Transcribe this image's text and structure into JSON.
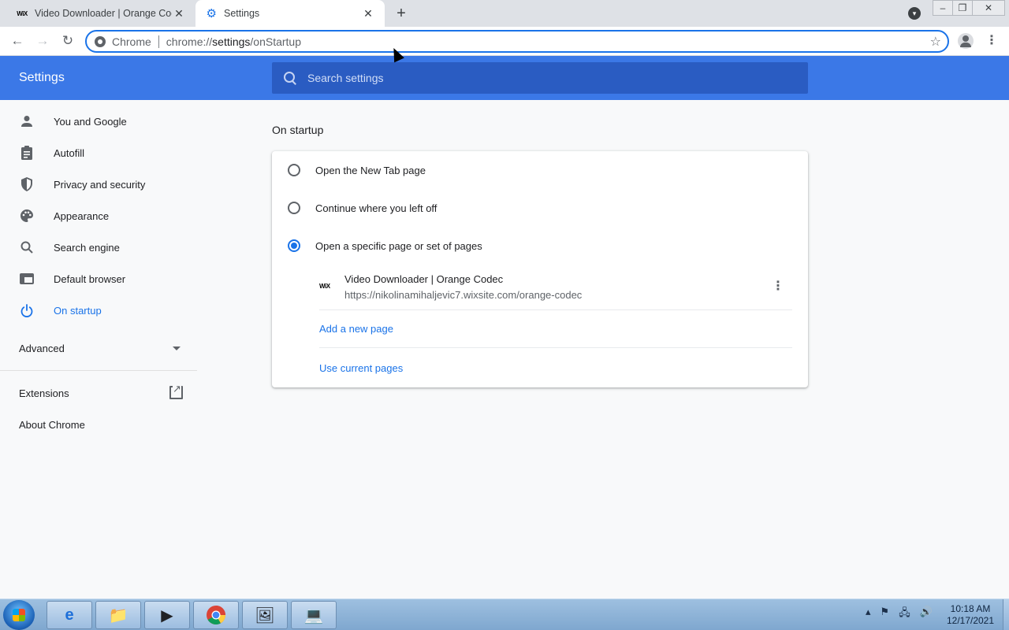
{
  "tabs": [
    {
      "title": "Video Downloader | Orange Cod",
      "favicon": "wix",
      "active": false
    },
    {
      "title": "Settings",
      "favicon": "gear-icon",
      "active": true
    }
  ],
  "toolbar": {
    "scheme_label": "Chrome",
    "url_prefix": "chrome://",
    "url_host": "settings",
    "url_path": "/onStartup"
  },
  "header": {
    "title": "Settings",
    "search_placeholder": "Search settings"
  },
  "sidebar": {
    "items": [
      {
        "label": "You and Google",
        "icon": "person-icon"
      },
      {
        "label": "Autofill",
        "icon": "clipboard-icon"
      },
      {
        "label": "Privacy and security",
        "icon": "shield-icon"
      },
      {
        "label": "Appearance",
        "icon": "palette-icon"
      },
      {
        "label": "Search engine",
        "icon": "search-icon"
      },
      {
        "label": "Default browser",
        "icon": "browser-window-icon"
      },
      {
        "label": "On startup",
        "icon": "power-icon",
        "selected": true
      }
    ],
    "advanced_label": "Advanced",
    "extensions_label": "Extensions",
    "about_label": "About Chrome"
  },
  "main": {
    "section_title": "On startup",
    "options": [
      {
        "label": "Open the New Tab page",
        "checked": false
      },
      {
        "label": "Continue where you left off",
        "checked": false
      },
      {
        "label": "Open a specific page or set of pages",
        "checked": true
      }
    ],
    "startup_pages": [
      {
        "title": "Video Downloader | Orange Codec",
        "url": "https://nikolinamihaljevic7.wixsite.com/orange-codec",
        "favicon_text": "WiX"
      }
    ],
    "add_page_label": "Add a new page",
    "use_current_label": "Use current pages"
  },
  "taskbar": {
    "time": "10:18 AM",
    "date": "12/17/2021"
  },
  "colors": {
    "accent": "#1a73e8",
    "header": "#3b78e7",
    "search_bg": "#2a5cc2"
  }
}
